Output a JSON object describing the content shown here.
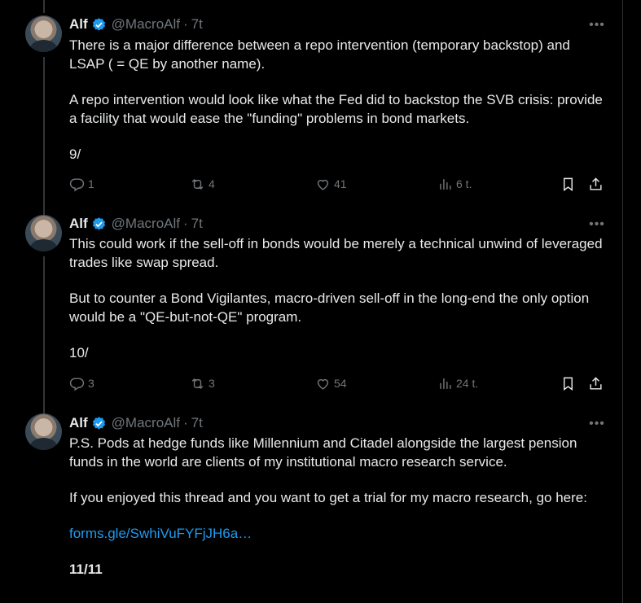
{
  "tweets": [
    {
      "author": {
        "name": "Alf",
        "handle": "@MacroAlf",
        "time": "7t"
      },
      "paragraphs": [
        "There is a major difference between a repo intervention (temporary backstop) and LSAP ( = QE by another name).",
        "A repo intervention would look like what the Fed did to backstop the SVB crisis: provide a facility that would ease the \"funding\" problems in bond markets.",
        "9/"
      ],
      "actions": {
        "replies": "1",
        "reposts": "4",
        "likes": "41",
        "views": "6 t."
      }
    },
    {
      "author": {
        "name": "Alf",
        "handle": "@MacroAlf",
        "time": "7t"
      },
      "paragraphs": [
        "This could work if the sell-off in bonds would be merely a technical unwind of leveraged trades like swap spread.",
        "But to counter a Bond Vigilantes, macro-driven sell-off in the long-end the only option would be a \"QE-but-not-QE\" program.",
        "10/"
      ],
      "actions": {
        "replies": "3",
        "reposts": "3",
        "likes": "54",
        "views": "24 t."
      }
    },
    {
      "author": {
        "name": "Alf",
        "handle": "@MacroAlf",
        "time": "7t"
      },
      "paragraphs": [
        "P.S. Pods at hedge funds like Millennium and Citadel alongside the largest pension funds in the world are clients of my institutional macro research service.",
        "If you enjoyed this thread and you want to get a trial for my macro research, go here:",
        "11/11"
      ],
      "link": "forms.gle/SwhiVuFYFjJH6a…"
    }
  ],
  "icons": {
    "verified": "verified-badge-icon",
    "more": "more-icon",
    "reply": "reply-icon",
    "repost": "repost-icon",
    "like": "like-icon",
    "views": "views-icon",
    "bookmark": "bookmark-icon",
    "share": "share-icon"
  },
  "colors": {
    "background": "#000000",
    "text": "#e7e9ea",
    "muted": "#71767b",
    "link": "#1d9bf0",
    "verified": "#1d9bf0"
  }
}
